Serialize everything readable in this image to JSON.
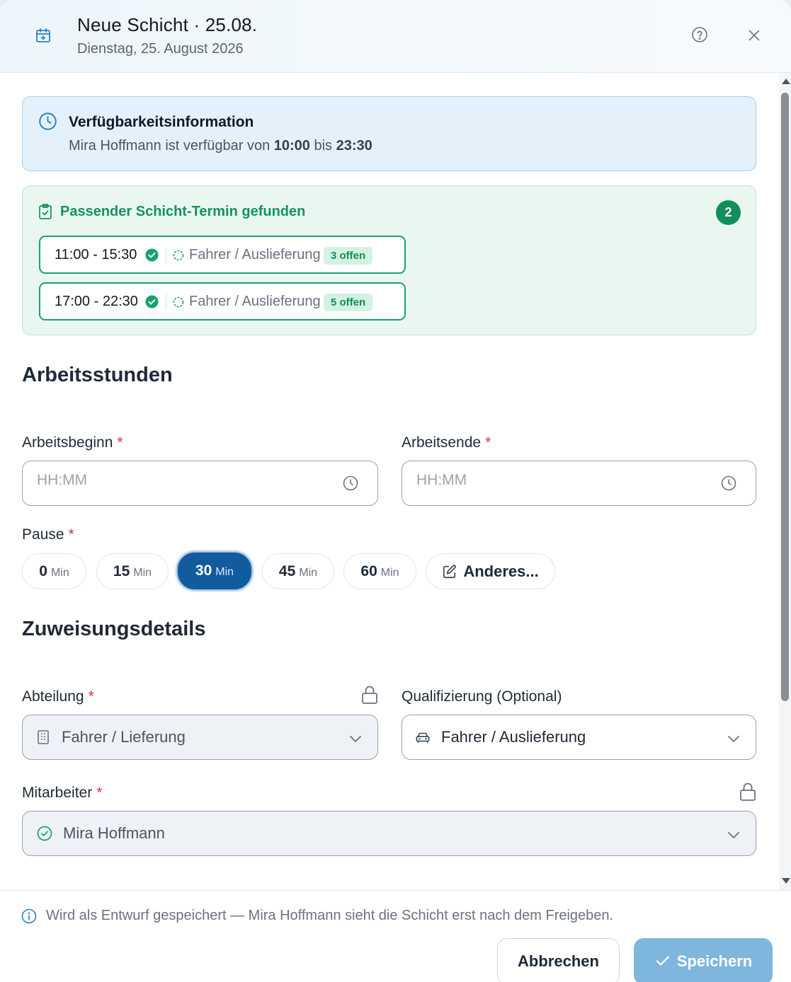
{
  "header": {
    "title": "Neue Schicht · 25.08.",
    "subtitle": "Dienstag, 25. August 2026",
    "icons": [
      "calendar-plus-icon",
      "help-icon",
      "close-icon"
    ]
  },
  "availability": {
    "title": "Verfügbarkeitsinformation",
    "text_prefix": "Mira Hoffmann ist verfügbar von ",
    "from": "10:00",
    "text_mid": " bis ",
    "to": "23:30"
  },
  "matching": {
    "title": "Passender Schicht-Termin gefunden",
    "count": "2",
    "options": [
      {
        "time": "11:00 - 15:30",
        "qualification": "Fahrer / Auslieferung",
        "open": "3 offen"
      },
      {
        "time": "17:00 - 22:30",
        "qualification": "Fahrer / Auslieferung",
        "open": "5 offen"
      }
    ]
  },
  "work_hours": {
    "section_title": "Arbeitsstunden",
    "start_label": "Arbeitsbeginn",
    "end_label": "Arbeitsende",
    "required_mark": "*",
    "start_placeholder": "HH:MM",
    "end_placeholder": "HH:MM",
    "pause_label": "Pause",
    "pause_unit": "Min",
    "pause_options": [
      "0",
      "15",
      "30",
      "45",
      "60"
    ],
    "pause_selected": "30",
    "pause_other": "Anderes..."
  },
  "assignment": {
    "section_title": "Zuweisungsdetails",
    "department_label": "Abteilung",
    "department_value": "Fahrer / Lieferung",
    "qualification_label": "Qualifizierung (Optional)",
    "qualification_value": "Fahrer / Auslieferung",
    "employee_label": "Mitarbeiter",
    "employee_value": "Mira Hoffmann"
  },
  "footer": {
    "note": "Wird als Entwurf gespeichert — Mira Hoffmann sieht die Schicht erst nach dem Freigeben.",
    "cancel_label": "Abbrechen",
    "save_label": "Speichern"
  },
  "colors": {
    "primary": "#125b9c",
    "success": "#0f8f5c",
    "info_bg": "#e4f1fb",
    "success_bg": "#eaf7f1",
    "required": "#d6334a",
    "save_disabled": "#7fb6dd"
  }
}
